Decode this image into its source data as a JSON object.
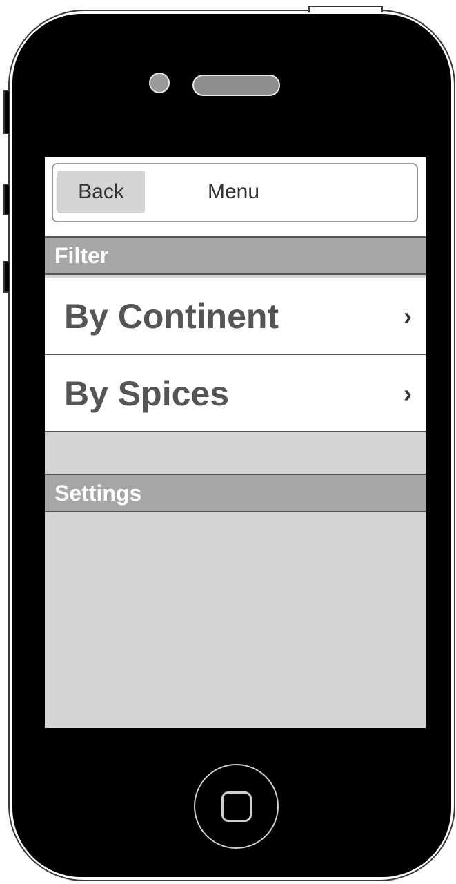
{
  "navbar": {
    "back_label": "Back",
    "title": "Menu"
  },
  "sections": {
    "filter": {
      "header": "Filter",
      "items": [
        {
          "label": "By Continent",
          "chevron": "›"
        },
        {
          "label": "By Spices",
          "chevron": "›"
        }
      ]
    },
    "settings": {
      "header": "Settings"
    }
  },
  "icons": {
    "chevron": "chevron-right-icon",
    "home": "home-button-icon",
    "camera": "camera-icon",
    "speaker": "speaker-icon"
  },
  "colors": {
    "section_header_bg": "#a6a6a6",
    "screen_bg": "#d4d4d4",
    "row_bg": "#ffffff",
    "text_dark": "#555555"
  }
}
